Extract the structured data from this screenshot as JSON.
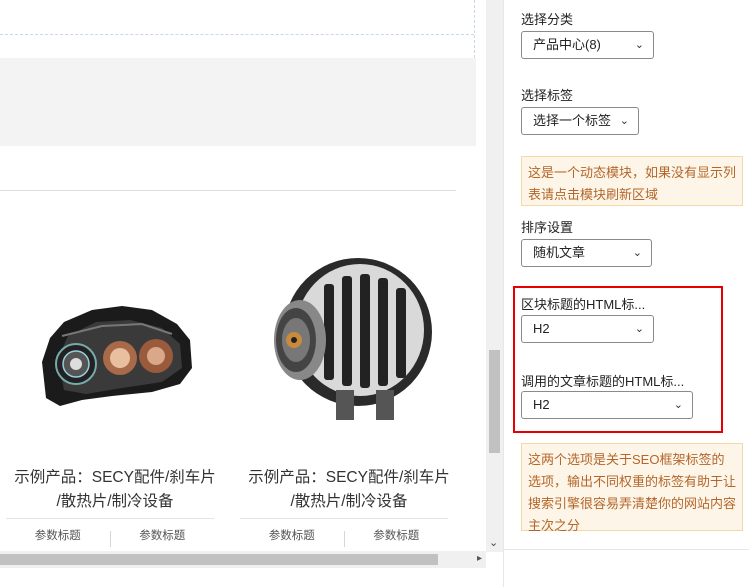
{
  "products": [
    {
      "title_line1": "示例产品：SECY配件/刹车片",
      "title_line2": "/散热片/制冷设备",
      "image": "car-headlight",
      "param_left": "参数标题",
      "param_right": "参数标题"
    },
    {
      "title_line1": "示例产品：SECY配件/刹车片",
      "title_line2": "/散热片/制冷设备",
      "image": "car-alternator",
      "param_left": "参数标题",
      "param_right": "参数标题"
    }
  ],
  "panel": {
    "category": {
      "label": "选择分类",
      "value": "产品中心(8)"
    },
    "tag": {
      "label": "选择标签",
      "value": "选择一个标签"
    },
    "dynamic_note": "这是一个动态模块，如果没有显示列表请点击模块刷新区域",
    "sort": {
      "label": "排序设置",
      "value": "随机文章"
    },
    "block_title_html": {
      "label": "区块标题的HTML标...",
      "value": "H2"
    },
    "post_title_html": {
      "label": "调用的文章标题的HTML标...",
      "value": "H2"
    },
    "seo_note": "这两个选项是关于SEO框架标签的选项，输出不同权重的标签有助于让搜索引擎很容易弄清楚你的网站内容主次之分"
  },
  "icons": {
    "chevron": "chevron-down-icon",
    "scroll_down": "scroll-down-arrow-icon",
    "scroll_right": "scroll-right-arrow-icon"
  },
  "colors": {
    "highlight": "#e60000",
    "note_bg": "#fdf5e8",
    "note_text": "#b4662a"
  }
}
